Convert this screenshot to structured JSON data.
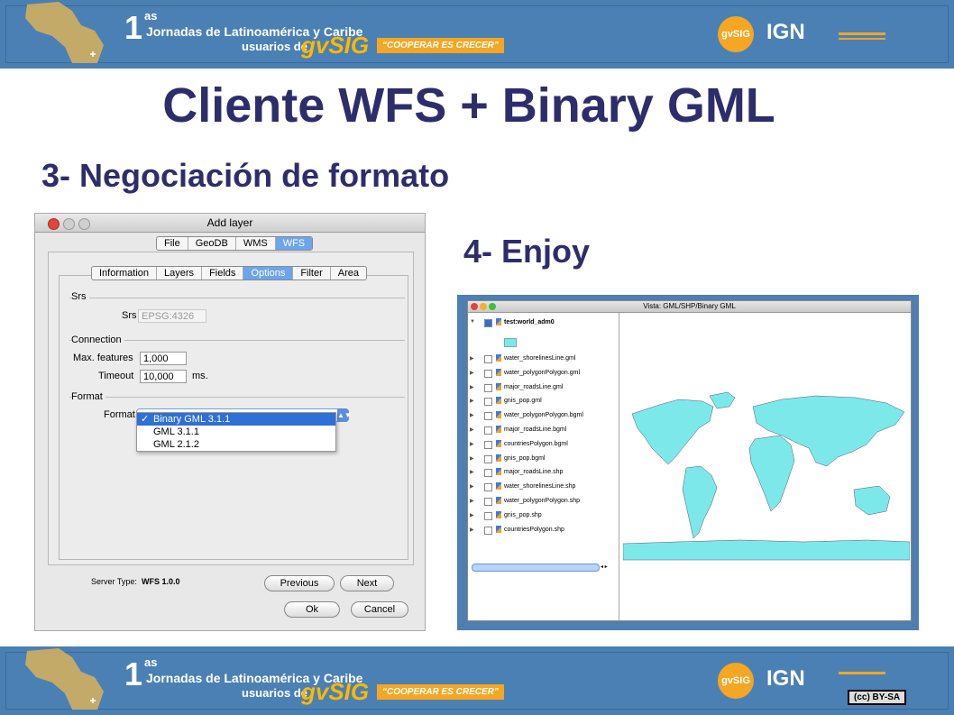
{
  "banner": {
    "number": "1",
    "superscript": "as",
    "line1": "Jornadas de Latinoamérica y Caribe",
    "line2": "usuarios de",
    "brand": "gvSIG",
    "slogan": "“COOPERAR ES CRECER”",
    "logo_gvsig": "gvSIG",
    "logo_ign": "IGN",
    "license": "(cc) BY-SA"
  },
  "slide": {
    "title": "Cliente WFS + Binary GML",
    "step3": "3- Negociación de formato",
    "step4": "4- Enjoy"
  },
  "dialog": {
    "title": "Add layer",
    "source_tabs": [
      "File",
      "GeoDB",
      "WMS",
      "WFS"
    ],
    "active_source_tab": "WFS",
    "option_tabs": [
      "Information",
      "Layers",
      "Fields",
      "Options",
      "Filter",
      "Area"
    ],
    "active_option_tab": "Options",
    "srs_group": "Srs",
    "srs_label": "Srs",
    "srs_value": "EPSG:4326",
    "connection_group": "Connection",
    "max_features_label": "Max. features",
    "max_features_value": "1,000",
    "timeout_label": "Timeout",
    "timeout_value": "10,000",
    "timeout_unit": "ms.",
    "format_group": "Format",
    "format_label": "Format",
    "format_options": [
      "Binary GML 3.1.1",
      "GML 3.1.1",
      "GML 2.1.2"
    ],
    "check_mark": "✓",
    "server_type_label": "Server Type:",
    "server_type_value": "WFS 1.0.0",
    "previous": "Previous",
    "next": "Next",
    "ok": "Ok",
    "cancel": "Cancel"
  },
  "gvsig": {
    "window_title": "Vista: GML/SHP/Binary GML",
    "root_layer": "test:world_adm0",
    "layers": [
      "water_shorelinesLine.gml",
      "water_polygonPolygon.gml",
      "major_roadsLine.gml",
      "gnis_pop.gml",
      "water_polygonPolygon.bgml",
      "major_roadsLine.bgml",
      "countriesPolygon.bgml",
      "gnis_pop.bgml",
      "major_roadsLine.shp",
      "water_shorelinesLine.shp",
      "water_polygonPolygon.shp",
      "gnis_pop.shp",
      "countriesPolygon.shp"
    ],
    "map_fill": "#7de8ea"
  },
  "colors": {
    "title": "#2e2d6b",
    "banner": "#4a7fb3",
    "accent": "#f5a623",
    "selection": "#2f6fd6"
  }
}
